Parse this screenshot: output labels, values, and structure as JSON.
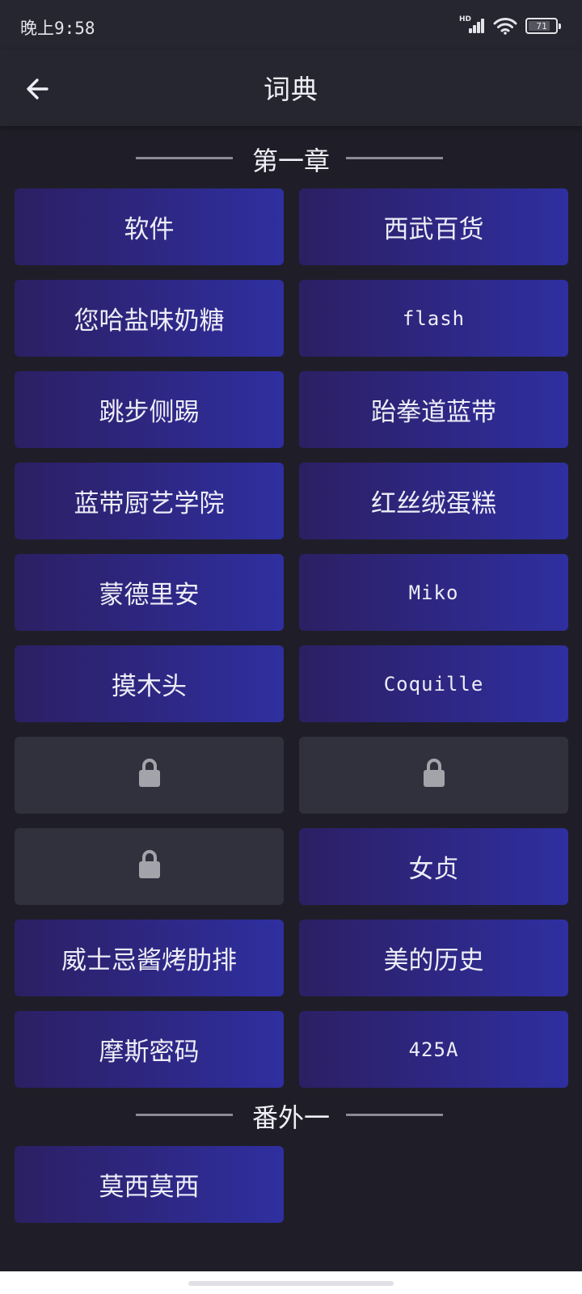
{
  "status_bar": {
    "time": "晚上9:58",
    "network_label": "HD",
    "battery_level": "71"
  },
  "app_bar": {
    "title": "词典",
    "back_icon": "arrow-left-icon"
  },
  "sections": [
    {
      "title": "第一章",
      "entries": [
        {
          "label": "软件",
          "locked": false,
          "latin": false
        },
        {
          "label": "西武百货",
          "locked": false,
          "latin": false
        },
        {
          "label": "您哈盐味奶糖",
          "locked": false,
          "latin": false
        },
        {
          "label": "flash",
          "locked": false,
          "latin": true
        },
        {
          "label": "跳步侧踢",
          "locked": false,
          "latin": false
        },
        {
          "label": "跆拳道蓝带",
          "locked": false,
          "latin": false
        },
        {
          "label": "蓝带厨艺学院",
          "locked": false,
          "latin": false
        },
        {
          "label": "红丝绒蛋糕",
          "locked": false,
          "latin": false
        },
        {
          "label": "蒙德里安",
          "locked": false,
          "latin": false
        },
        {
          "label": "Miko",
          "locked": false,
          "latin": true
        },
        {
          "label": "摸木头",
          "locked": false,
          "latin": false
        },
        {
          "label": "Coquille",
          "locked": false,
          "latin": true
        },
        {
          "label": "",
          "locked": true,
          "icon": "lock-icon"
        },
        {
          "label": "",
          "locked": true,
          "icon": "lock-icon"
        },
        {
          "label": "",
          "locked": true,
          "icon": "lock-icon"
        },
        {
          "label": "女贞",
          "locked": false,
          "latin": false
        },
        {
          "label": "威士忌酱烤肋排",
          "locked": false,
          "latin": false
        },
        {
          "label": "美的历史",
          "locked": false,
          "latin": false
        },
        {
          "label": "摩斯密码",
          "locked": false,
          "latin": false
        },
        {
          "label": "425A",
          "locked": false,
          "latin": true
        }
      ]
    },
    {
      "title": "番外一",
      "entries": [
        {
          "label": "莫西莫西",
          "locked": false,
          "latin": false
        }
      ]
    }
  ],
  "colors": {
    "background": "#1f1e28",
    "app_bar": "#262630",
    "card_gradient_start": "#2c1f63",
    "card_gradient_end": "#2f2fa0",
    "locked_card": "#30313c",
    "lock_icon": "#a3a3aa"
  }
}
